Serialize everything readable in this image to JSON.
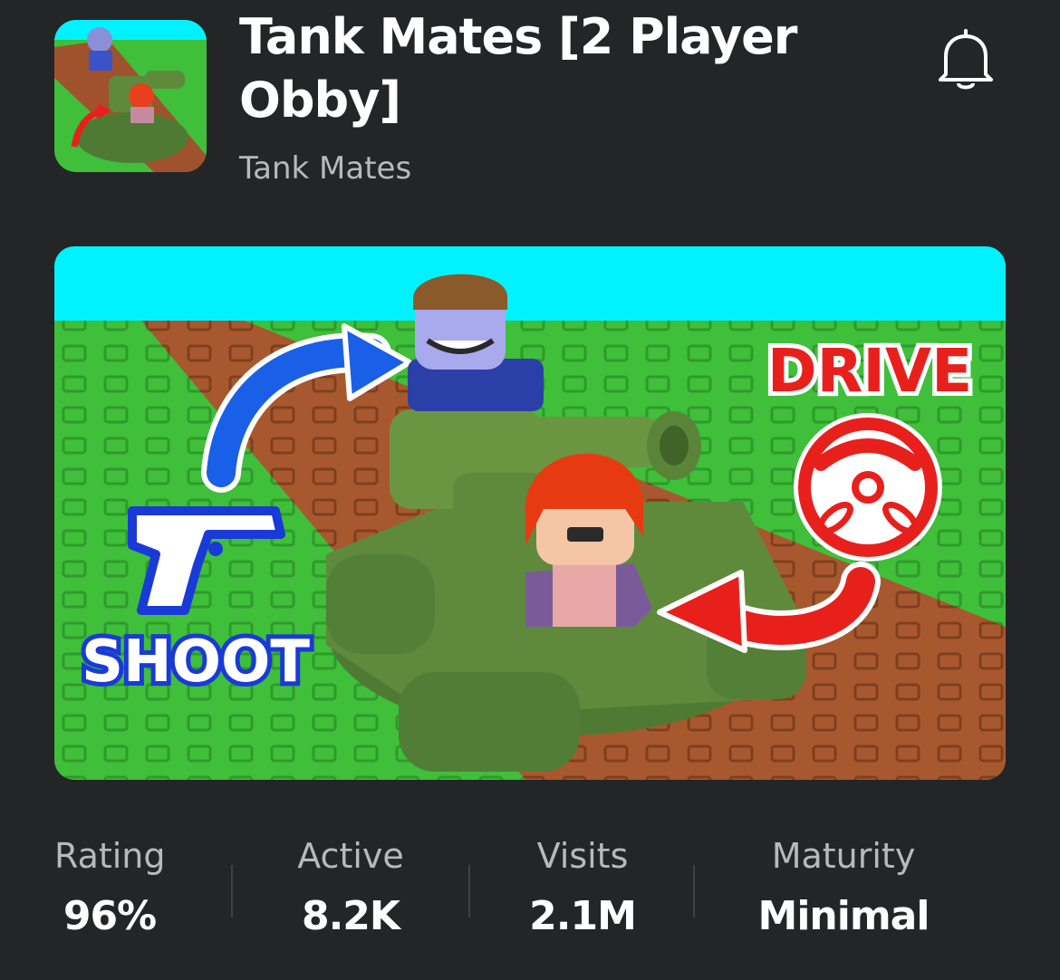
{
  "game": {
    "title": "Tank Mates [2 Player Obby]",
    "title_line1": "Tank Mates [2 Player",
    "title_line2": "Obby]",
    "creator": "Tank Mates"
  },
  "header": {
    "notify_icon": "bell-icon"
  },
  "banner": {
    "left_caption": "SHOOT",
    "right_caption": "DRIVE",
    "icons": [
      "pistol-icon",
      "steering-wheel-icon",
      "arrow-icon"
    ]
  },
  "stats": [
    {
      "label": "Rating",
      "value": "96%"
    },
    {
      "label": "Active",
      "value": "8.2K"
    },
    {
      "label": "Visits",
      "value": "2.1M"
    },
    {
      "label": "Maturity",
      "value": "Minimal"
    }
  ],
  "colors": {
    "background": "#232527",
    "sky": "#00f2ff",
    "grass": "#3fbf3a",
    "road": "#a0522d",
    "tank": "#5f8a3c",
    "accent_red": "#e8201c",
    "accent_blue": "#1a5fe8"
  }
}
